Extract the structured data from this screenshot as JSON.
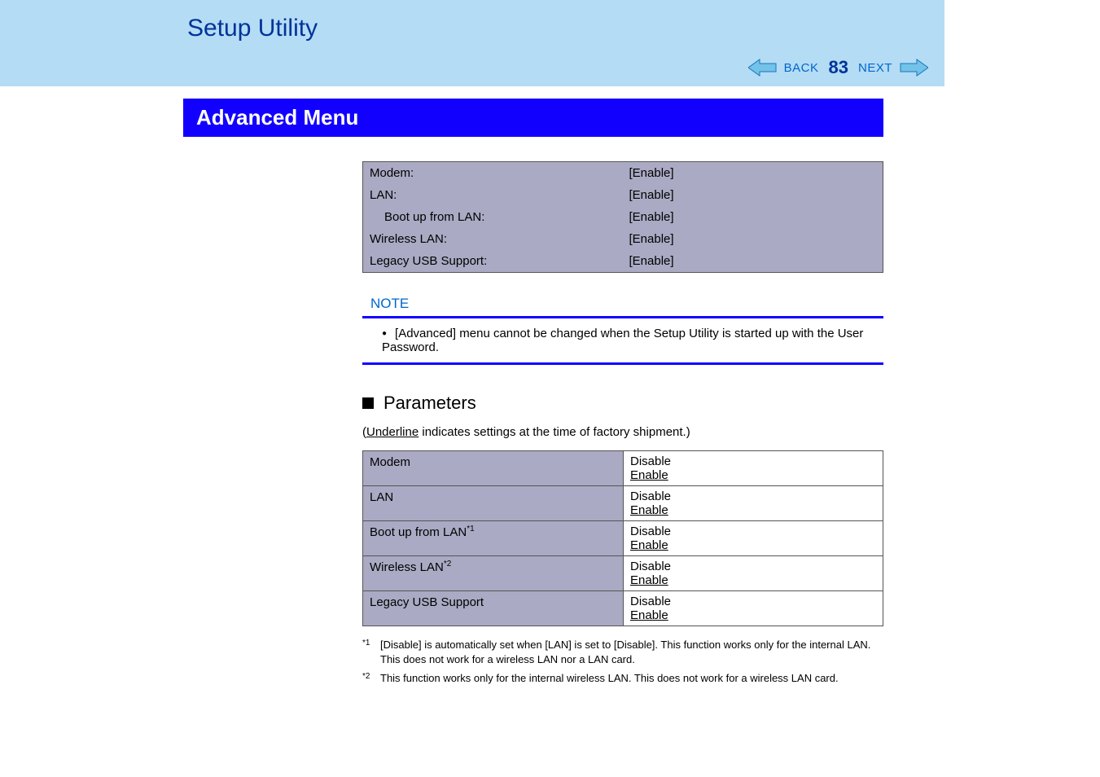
{
  "header": {
    "title": "Setup Utility",
    "back_label": "BACK",
    "next_label": "NEXT",
    "page_number": "83"
  },
  "section_title": "Advanced Menu",
  "settings": [
    {
      "label": "Modem:",
      "value": "[Enable]",
      "indent": false
    },
    {
      "label": "LAN:",
      "value": "[Enable]",
      "indent": false
    },
    {
      "label": "Boot up from LAN:",
      "value": "[Enable]",
      "indent": true
    },
    {
      "label": "Wireless LAN:",
      "value": "[Enable]",
      "indent": false
    },
    {
      "label": "Legacy USB Support:",
      "value": "[Enable]",
      "indent": false
    }
  ],
  "note": {
    "label": "NOTE",
    "text": "[Advanced] menu cannot be changed when the Setup Utility is started up with the User Password."
  },
  "parameters": {
    "heading": "Parameters",
    "factory_prefix": "(",
    "factory_underlined": "Underline",
    "factory_suffix": " indicates settings at the time of factory shipment.)",
    "rows": [
      {
        "name": "Modem",
        "sup": "",
        "opt1": "Disable",
        "opt2": "Enable"
      },
      {
        "name": "LAN",
        "sup": "",
        "opt1": "Disable",
        "opt2": "Enable"
      },
      {
        "name": "Boot up from LAN",
        "sup": "*1",
        "opt1": "Disable",
        "opt2": "Enable"
      },
      {
        "name": "Wireless LAN",
        "sup": "*2",
        "opt1": "Disable",
        "opt2": "Enable"
      },
      {
        "name": "Legacy USB Support",
        "sup": "",
        "opt1": "Disable",
        "opt2": "Enable"
      }
    ]
  },
  "footnotes": [
    {
      "mark": "*1",
      "text": "[Disable] is automatically set when [LAN] is set to [Disable]. This function works only for the internal LAN.  This does not work for a wireless LAN nor a LAN card."
    },
    {
      "mark": "*2",
      "text": "This function works only for the internal wireless LAN.  This does not work for a wireless LAN card."
    }
  ]
}
